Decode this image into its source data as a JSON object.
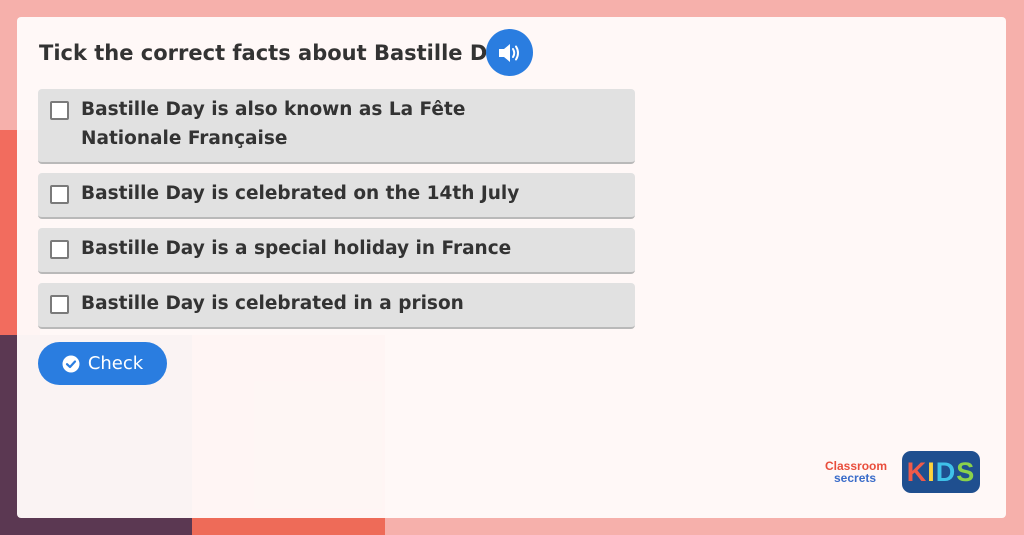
{
  "question": {
    "title": "Tick the correct facts about Bastille Day"
  },
  "options": [
    {
      "label": "Bastille Day is also known as La Fête Nationale Française",
      "checked": false
    },
    {
      "label": "Bastille Day is celebrated on the 14th July",
      "checked": false
    },
    {
      "label": "Bastille Day is a special holiday in France",
      "checked": false
    },
    {
      "label": "Bastille Day is celebrated in a prison",
      "checked": false
    }
  ],
  "actions": {
    "check_label": "Check"
  },
  "branding": {
    "classroom_line1": "Classroom",
    "classroom_line2": "secrets",
    "kids_k": "K",
    "kids_i": "I",
    "kids_d": "D",
    "kids_s": "S"
  },
  "icons": {
    "audio": "speaker-icon",
    "check": "check-circle-icon"
  },
  "colors": {
    "accent": "#2a7de0",
    "option_bg": "#e1e1e1",
    "border_pink": "#f6b0ab"
  }
}
